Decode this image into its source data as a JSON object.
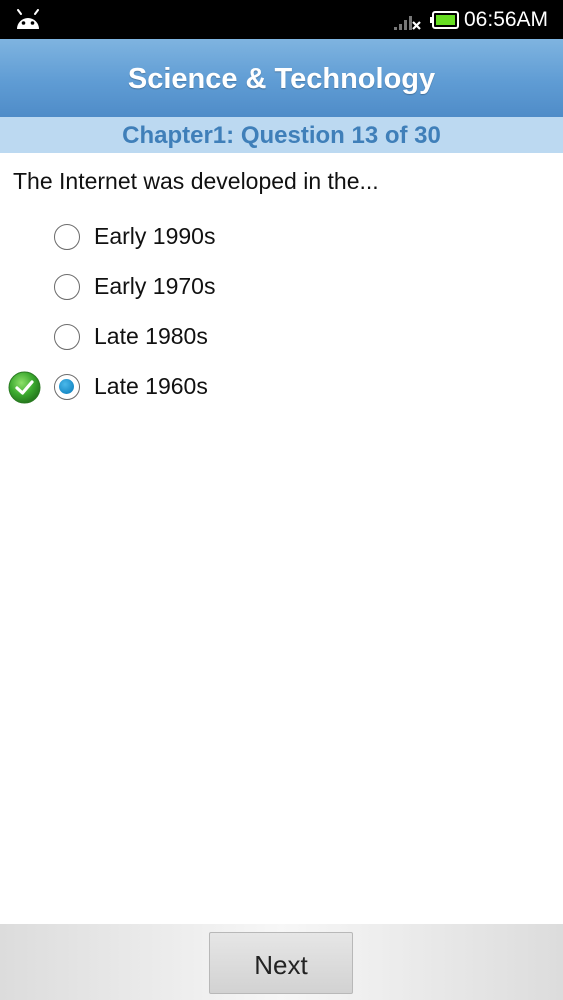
{
  "status_bar": {
    "time": "06:56AM",
    "icons": [
      "android-icon",
      "signal-icon",
      "battery-icon"
    ]
  },
  "header": {
    "title": "Science & Technology",
    "subtitle": "Chapter1: Question 13 of 30"
  },
  "question": {
    "text": "The Internet was developed in the...",
    "options": [
      {
        "label": "Early 1990s",
        "selected": false,
        "correct": false
      },
      {
        "label": "Early 1970s",
        "selected": false,
        "correct": false
      },
      {
        "label": "Late 1980s",
        "selected": false,
        "correct": false
      },
      {
        "label": "Late 1960s",
        "selected": true,
        "correct": true
      }
    ]
  },
  "footer": {
    "next_label": "Next"
  },
  "colors": {
    "title_bar": "#5f9cd4",
    "chapter_bar": "#bcd9f1",
    "chapter_text": "#3f7fb9",
    "radio_selected": "#1a8cc8",
    "check_green": "#3aa82e"
  }
}
